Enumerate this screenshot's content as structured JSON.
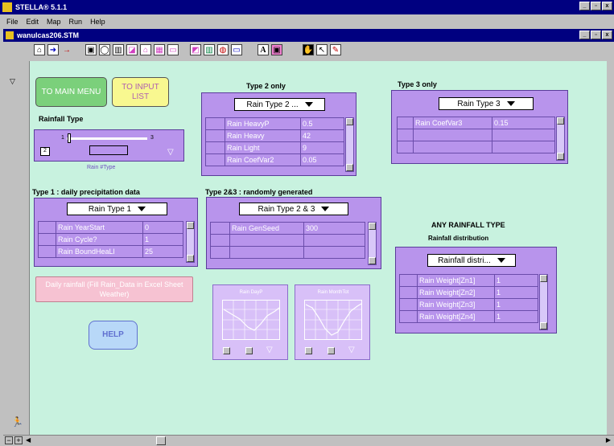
{
  "app": {
    "title": "STELLA® 5.1.1"
  },
  "menu": [
    "File",
    "Edit",
    "Map",
    "Run",
    "Help"
  ],
  "doc": {
    "title": "wanulcas206.STM"
  },
  "buttons": {
    "to_main_menu": "TO MAIN MENU",
    "to_input_list": "TO INPUT LIST",
    "help": "HELP",
    "daily_rainfall": "Daily rainfall (Fill Rain_Data in Excel Sheet Weather)"
  },
  "rainfall_type": {
    "title": "Rainfall Type",
    "slider_min": "1",
    "slider_max": "3",
    "slider_value": "2",
    "var_name": "Rain #Type"
  },
  "type1": {
    "title": "Type 1 : daily precipitation data",
    "dropdown": "Rain Type 1",
    "rows": [
      {
        "label": "Rain YearStart",
        "value": "0"
      },
      {
        "label": "Rain Cycle?",
        "value": "1"
      },
      {
        "label": "Rain BoundHeaLl",
        "value": "25"
      }
    ]
  },
  "type2": {
    "title": "Type 2 only",
    "dropdown": "Rain Type 2 ...",
    "rows": [
      {
        "label": "Rain HeavyP",
        "value": "0.5"
      },
      {
        "label": "Rain Heavy",
        "value": "42"
      },
      {
        "label": "Rain Light",
        "value": "9"
      },
      {
        "label": "Rain CoefVar2",
        "value": "0.05"
      }
    ]
  },
  "type3": {
    "title": "Type 3 only",
    "dropdown": "Rain Type 3",
    "rows": [
      {
        "label": "Rain CoefVar3",
        "value": "0.15"
      }
    ]
  },
  "type23": {
    "title": "Type 2&3 : randomly generated",
    "dropdown": "Rain Type 2 & 3",
    "rows": [
      {
        "label": "Rain GenSeed",
        "value": "300"
      }
    ]
  },
  "any": {
    "title": "ANY RAINFALL TYPE",
    "subtitle": "Rainfall distribution",
    "dropdown": "Rainfall distri...",
    "rows": [
      {
        "label": "Rain Weight[Zn1]",
        "value": "1"
      },
      {
        "label": "Rain Weight[Zn2]",
        "value": "1"
      },
      {
        "label": "Rain Weight[Zn3]",
        "value": "1"
      },
      {
        "label": "Rain Weight[Zn4]",
        "value": "1"
      }
    ]
  },
  "graphs": [
    {
      "title": "Rain DayP"
    },
    {
      "title": "Rain MonthTot"
    }
  ],
  "toolbar_text": {
    "text_tool": "A"
  }
}
